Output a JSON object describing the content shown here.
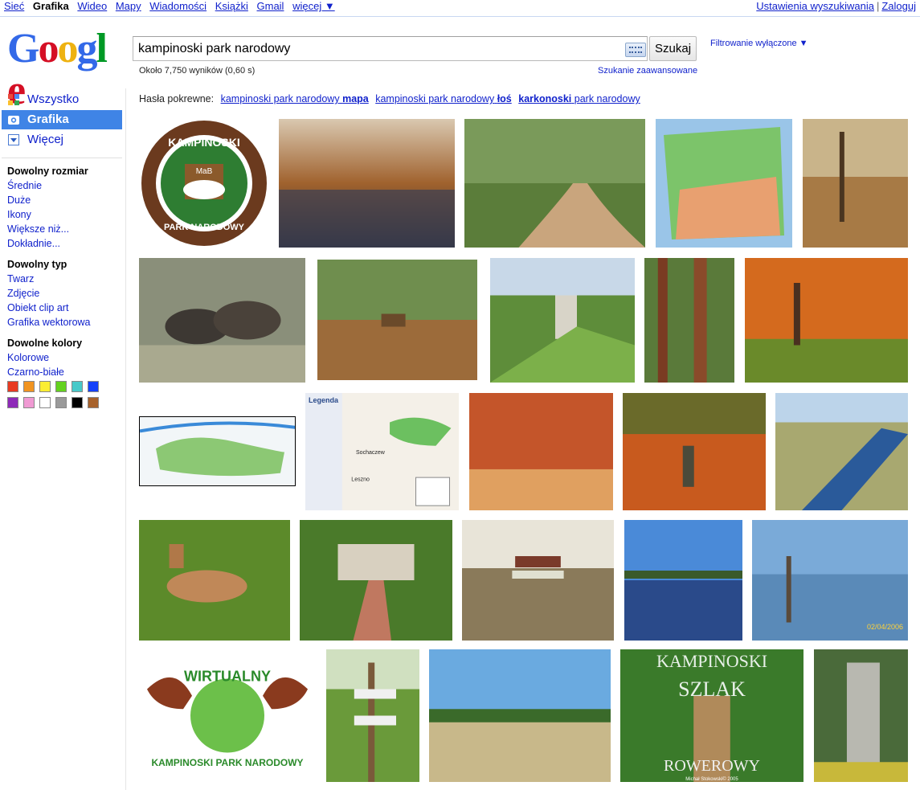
{
  "topbar": {
    "links": [
      "Sieć",
      "Grafika",
      "Wideo",
      "Mapy",
      "Wiadomości",
      "Książki",
      "Gmail",
      "więcej ▼"
    ],
    "current": "Grafika",
    "settings": "Ustawienia wyszukiwania",
    "separator": "|",
    "login": "Zaloguj"
  },
  "logo": {
    "letters": [
      "G",
      "o",
      "o",
      "g",
      "l",
      "e"
    ],
    "colors": [
      "#3369e8",
      "#d50f25",
      "#eeb211",
      "#3369e8",
      "#009925",
      "#d50f25"
    ]
  },
  "search": {
    "value": "kampinoski park narodowy",
    "button": "Szukaj",
    "filter": "Filtrowanie wyłączone ▼",
    "stats": "Około 7,750 wyników (0,60 s)",
    "advanced": "Szukanie zaawansowane"
  },
  "nav": {
    "all": "Wszystko",
    "images": "Grafika",
    "more": "Więcej"
  },
  "facets": {
    "size": {
      "heading": "Dowolny rozmiar",
      "options": [
        "Średnie",
        "Duże",
        "Ikony",
        "Większe niż...",
        "Dokładnie..."
      ]
    },
    "type": {
      "heading": "Dowolny typ",
      "options": [
        "Twarz",
        "Zdjęcie",
        "Obiekt clip art",
        "Grafika wektorowa"
      ]
    },
    "colors": {
      "heading": "Dowolne kolory",
      "options": [
        "Kolorowe",
        "Czarno-białe"
      ],
      "swatches": [
        "#e83a21",
        "#f19420",
        "#fbed33",
        "#64d21f",
        "#48c9c9",
        "#1541f9",
        "#8e2ab8",
        "#f09ad3",
        "#ffffff",
        "#9a9a9a",
        "#000000",
        "#a7622c"
      ]
    }
  },
  "related": {
    "label": "Hasła pokrewne:",
    "items": [
      {
        "normal": "kampinoski park narodowy",
        "bold": "mapa",
        "bold_first": false
      },
      {
        "normal": "kampinoski park narodowy",
        "bold": "łoś",
        "bold_first": false
      },
      {
        "normal": "park narodowy",
        "bold": "karkonoski",
        "bold_first": true
      }
    ]
  },
  "images": [
    {
      "name": "emblem-kampinoski",
      "text": [
        "KAMPINOSKI",
        "PARK NARODOWY",
        "MaB"
      ]
    },
    {
      "name": "autumn-swamp"
    },
    {
      "name": "forest-road"
    },
    {
      "name": "poland-map"
    },
    {
      "name": "forest-bike"
    },
    {
      "name": "moose-pair"
    },
    {
      "name": "forest-signs"
    },
    {
      "name": "valley-rocks"
    },
    {
      "name": "pine-trunks"
    },
    {
      "name": "autumn-oaks"
    },
    {
      "name": "park-map-green"
    },
    {
      "name": "legend-map",
      "text": [
        "Legenda",
        "Sochaczew",
        "Leszno"
      ]
    },
    {
      "name": "autumn-alley"
    },
    {
      "name": "autumn-person"
    },
    {
      "name": "canal-water"
    },
    {
      "name": "roe-deer"
    },
    {
      "name": "garden-house"
    },
    {
      "name": "signpost-trees"
    },
    {
      "name": "lake-reflection"
    },
    {
      "name": "flooded-trees",
      "text": [
        "02/04/2006"
      ]
    },
    {
      "name": "wirtualny-logo",
      "text": [
        "WIRTUALNY",
        "KAMPINOSKI PARK NARODOWY"
      ]
    },
    {
      "name": "trail-signpost"
    },
    {
      "name": "meadow-sky"
    },
    {
      "name": "szlak-rowerowy",
      "text": [
        "KAMPINOSKI",
        "SZLAK",
        "ROWEROWY",
        "Michał Stokowski© 2005"
      ]
    },
    {
      "name": "rock-cliff"
    }
  ]
}
